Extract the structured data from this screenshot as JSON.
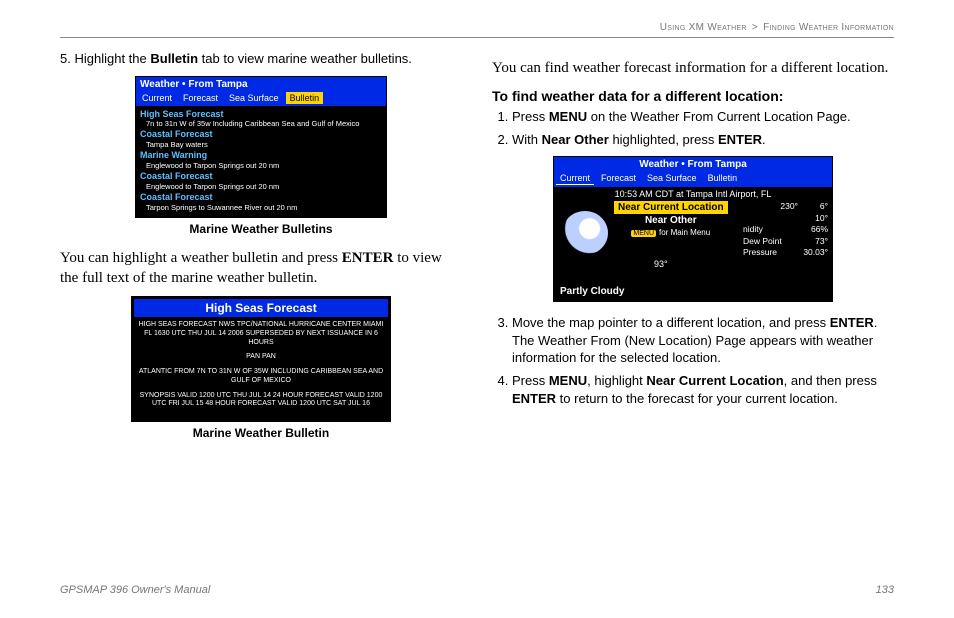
{
  "header": {
    "section": "Using XM Weather",
    "sub": "Finding Weather Information"
  },
  "left": {
    "step5_pre": "Highlight the ",
    "step5_bold": "Bulletin",
    "step5_post": " tab to view marine weather bulletins.",
    "fig1": {
      "title": "Weather • From Tampa",
      "tabs": [
        "Current",
        "Forecast",
        "Sea Surface",
        "Bulletin"
      ],
      "items": [
        {
          "t": "High Seas Forecast",
          "s": "7n to 31n W of 35w Including Caribbean Sea and Gulf of Mexico"
        },
        {
          "t": "Coastal Forecast",
          "s": "Tampa Bay waters"
        },
        {
          "t": "Marine Warning",
          "s": "Englewood to Tarpon Springs out 20 nm"
        },
        {
          "t": "Coastal Forecast",
          "s": "Englewood to Tarpon Springs out 20 nm"
        },
        {
          "t": "Coastal Forecast",
          "s": "Tarpon Springs to Suwannee River out 20 nm"
        }
      ],
      "caption": "Marine Weather Bulletins"
    },
    "para1_pre": "You can highlight a weather bulletin and press ",
    "para1_bold": "ENTER",
    "para1_post": " to view the full text of the marine weather bulletin.",
    "fig2": {
      "title": "High Seas Forecast",
      "lines": [
        "HIGH SEAS FORECAST   NWS TPC/NATIONAL HURRICANE CENTER MIAMI FL   1630 UTC THU JUL 14 2006 SUPERSEDED BY NEXT ISSUANCE IN 6 HOURS",
        "PAN PAN",
        "ATLANTIC FROM 7N TO 31N W OF 35W INCLUDING CARIBBEAN SEA AND GULF OF MEXICO",
        "SYNOPSIS VALID 1200 UTC THU JUL 14 24 HOUR FORECAST VALID 1200 UTC FRI JUL 15 48 HOUR FORECAST VALID 1200 UTC SAT JUL 16"
      ],
      "caption": "Marine Weather Bulletin"
    }
  },
  "right": {
    "intro": "You can find weather forecast information for a different location.",
    "section": "To find weather data for a different location:",
    "steps": [
      {
        "parts": [
          "Press ",
          "MENU",
          " on the Weather From Current Location Page."
        ]
      },
      {
        "parts": [
          "With ",
          "Near Other",
          " highlighted, press ",
          "ENTER",
          "."
        ]
      },
      {
        "parts": [
          "Move the map pointer to a different location, and press ",
          "ENTER",
          ". The Weather From (New Location) Page appears with weather information for the selected location."
        ]
      },
      {
        "parts": [
          "Press ",
          "MENU",
          ", highlight ",
          "Near Current Location",
          ", and then press ",
          "ENTER",
          " to return to the forecast for your current location."
        ]
      }
    ],
    "fig": {
      "title": "Weather • From Tampa",
      "tabs": [
        "Current",
        "Forecast",
        "Sea Surface",
        "Bulletin"
      ],
      "status": "10:53 AM CDT at Tampa Intl Airport, FL",
      "menu1": "Near Current Location",
      "menu2": "Near Other",
      "hint_chip": "MENU",
      "hint": "for Main Menu",
      "temp": "93°",
      "cond": "Partly Cloudy",
      "readings": [
        [
          "",
          "230°",
          "6°"
        ],
        [
          "",
          "",
          "10°"
        ],
        [
          "nidity",
          "",
          "66%"
        ],
        [
          "Dew Point",
          "",
          "73°"
        ],
        [
          "Pressure",
          "",
          "30.03°"
        ]
      ]
    }
  },
  "footer": {
    "left": "GPSMAP 396 Owner's Manual",
    "right": "133"
  }
}
